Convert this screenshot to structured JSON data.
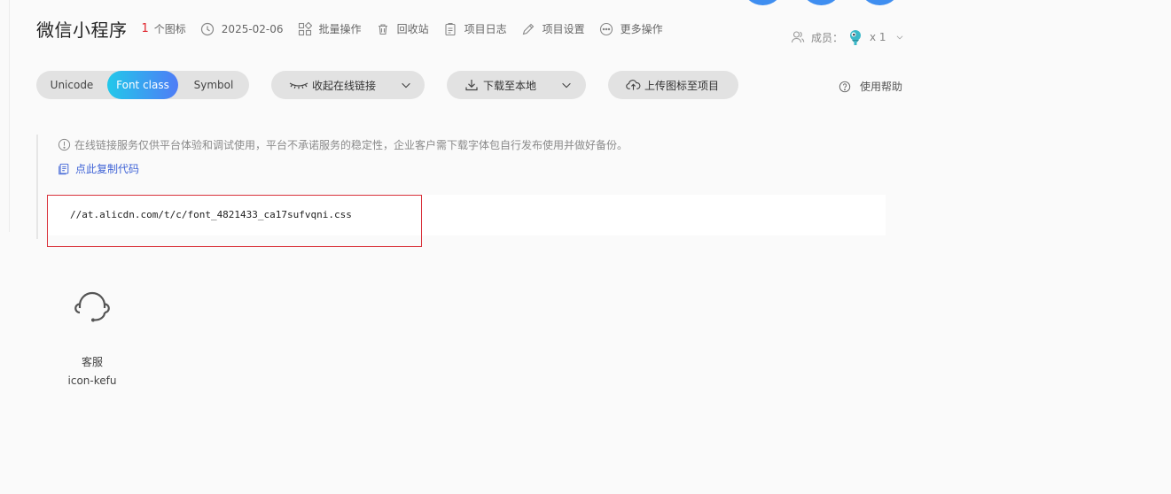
{
  "project": {
    "title": "微信小程序",
    "icon_count": "1",
    "icon_count_unit": "个图标",
    "date": "2025-02-06"
  },
  "header_actions": [
    {
      "label": "批量操作",
      "icon": "batch-grid-icon"
    },
    {
      "label": "回收站",
      "icon": "trash-icon"
    },
    {
      "label": "项目日志",
      "icon": "clipboard-icon"
    },
    {
      "label": "项目设置",
      "icon": "pencil-icon"
    },
    {
      "label": "更多操作",
      "icon": "more-dots-icon"
    }
  ],
  "members": {
    "label": "成员：",
    "count": "x 1"
  },
  "segmented": {
    "unicode": "Unicode",
    "fontclass": "Font class",
    "symbol": "Symbol",
    "active": "Font class"
  },
  "buttons": {
    "collapse_link": "收起在线链接",
    "download": "下载至本地",
    "upload": "上传图标至项目"
  },
  "help": {
    "label": "使用帮助"
  },
  "notice": {
    "warning": "在线链接服务仅供平台体验和调试使用，平台不承诺服务的稳定性，企业客户需下载字体包自行发布使用并做好备份。",
    "copy_label": "点此复制代码"
  },
  "code": {
    "url": "//at.alicdn.com/t/c/font_4821433_ca17sufvqni.css"
  },
  "icons": [
    {
      "name": "客服",
      "code": "icon-kefu",
      "glyph": "headset-icon"
    }
  ],
  "colors": {
    "accent_from": "#22c8ea",
    "accent_to": "#4f7cf6",
    "count_red": "#e0242c",
    "link_blue": "#3f63d6",
    "highlight_border": "#d9313a",
    "top_circle": "#3f8ef0"
  }
}
